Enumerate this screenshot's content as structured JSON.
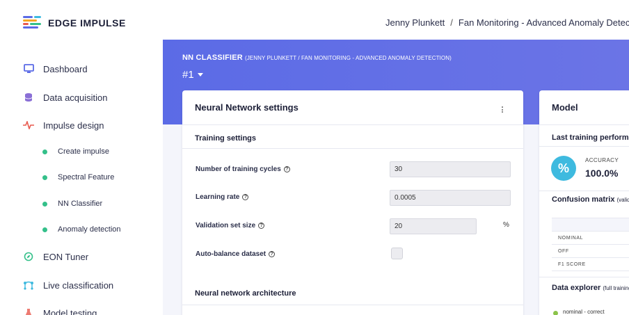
{
  "brand": {
    "name": "EDGE IMPULSE"
  },
  "breadcrumb": {
    "user": "Jenny Plunkett",
    "separator": "/",
    "project": "Fan Monitoring - Advanced Anomaly Detection"
  },
  "sidebar": {
    "items": [
      {
        "label": "Dashboard",
        "icon": "monitor-icon"
      },
      {
        "label": "Data acquisition",
        "icon": "database-icon"
      },
      {
        "label": "Impulse design",
        "icon": "pulse-icon"
      },
      {
        "label": "EON Tuner",
        "icon": "compass-icon"
      },
      {
        "label": "Live classification",
        "icon": "nodes-icon"
      },
      {
        "label": "Model testing",
        "icon": "flask-icon"
      }
    ],
    "subitems": [
      {
        "label": "Create impulse"
      },
      {
        "label": "Spectral Feature"
      },
      {
        "label": "NN Classifier"
      },
      {
        "label": "Anomaly detection"
      }
    ]
  },
  "header": {
    "title": "NN CLASSIFIER",
    "subtitle": "(JENNY PLUNKETT / FAN MONITORING - ADVANCED ANOMALY DETECTION)",
    "version": "#1"
  },
  "nn_card": {
    "title": "Neural Network settings",
    "training_title": "Training settings",
    "fields": [
      {
        "label": "Number of training cycles",
        "value": "30"
      },
      {
        "label": "Learning rate",
        "value": "0.0005"
      },
      {
        "label": "Validation set size",
        "value": "20",
        "unit": "%"
      },
      {
        "label": "Auto-balance dataset",
        "checked": false
      }
    ],
    "architecture_title": "Neural network architecture"
  },
  "model_card": {
    "title": "Model",
    "last_training": "Last training performance",
    "accuracy_label": "ACCURACY",
    "accuracy_value": "100.0%",
    "accuracy_icon": "%",
    "confusion_title": "Confusion matrix",
    "confusion_note": "(validation set)",
    "confusion_rows": [
      "NOMINAL",
      "OFF",
      "F1 SCORE"
    ],
    "explorer_title": "Data explorer",
    "explorer_note": "(full training set)",
    "legend_item": "nominal - correct"
  },
  "colors": {
    "accent": "#5b6be6",
    "green_dot": "#34c08a",
    "accuracy": "#3ebadf",
    "impulse_icon": "#e85a4f"
  }
}
